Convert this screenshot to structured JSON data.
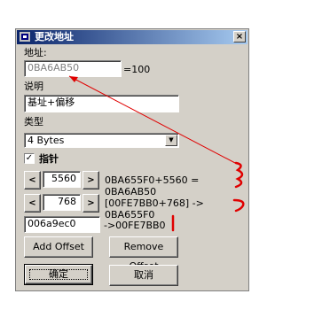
{
  "window": {
    "title": "更改地址",
    "close_glyph": "×"
  },
  "address": {
    "label": "地址:",
    "value": "0BA6AB50",
    "result": "=100"
  },
  "description": {
    "label": "说明",
    "value": "基址+偏移"
  },
  "type": {
    "label": "类型",
    "selected": "4 Bytes"
  },
  "pointer": {
    "checkbox_label": "指针",
    "checked": "✓",
    "offsets": [
      {
        "prev": "<",
        "value": "5560",
        "next": ">",
        "result": "0BA655F0+5560 = 0BA6AB50"
      },
      {
        "prev": "<",
        "value": "768",
        "next": ">",
        "result": "[00FE7BB0+768] -> 0BA655F0"
      }
    ],
    "base": {
      "value": "006a9ec0",
      "result": "->00FE7BB0"
    }
  },
  "buttons": {
    "add_offset": "Add Offset",
    "remove_offset": "Remove Offset",
    "ok": "确定",
    "cancel": "取消"
  },
  "annotation_color": "#e00000",
  "icons": [
    "app-icon",
    "close-icon",
    "dropdown-arrow-icon",
    "checkmark-icon"
  ]
}
